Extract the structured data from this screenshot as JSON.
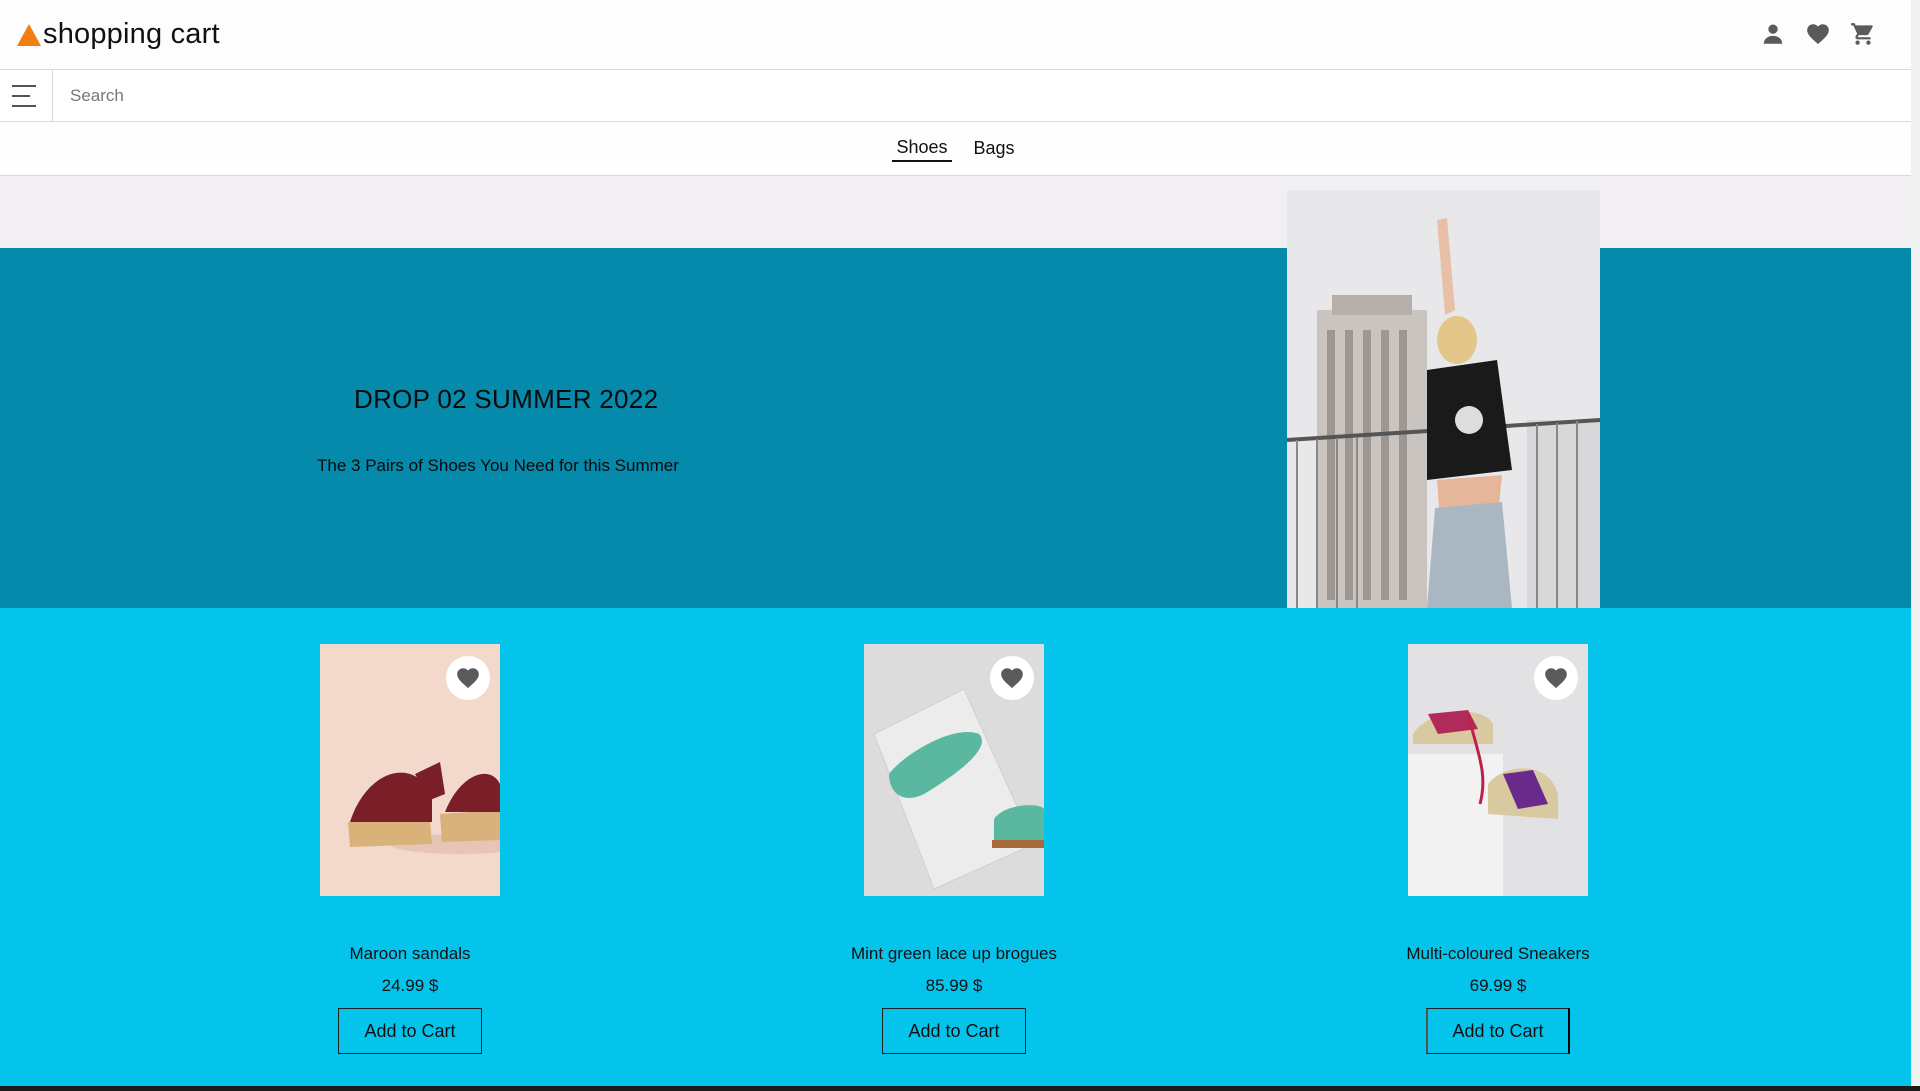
{
  "header": {
    "logo_text": "shopping cart",
    "logo_icon": "orange-triangle-logo",
    "icons": [
      "account-icon",
      "favorites-heart-icon",
      "cart-icon"
    ]
  },
  "search": {
    "placeholder": "Search",
    "value": "",
    "menu_icon": "hamburger-menu-icon"
  },
  "nav": {
    "tabs": [
      {
        "label": "Shoes",
        "active": true
      },
      {
        "label": "Bags",
        "active": false
      }
    ]
  },
  "hero": {
    "title": "DROP 02 SUMMER 2022",
    "subtitle": "The 3 Pairs of Shoes You Need for this Summer",
    "background_color": "#068aab"
  },
  "products": {
    "background_color": "#05c4ec",
    "items": [
      {
        "name": "Maroon sandals",
        "price": "24.99 $",
        "button": "Add to Cart"
      },
      {
        "name": "Mint green lace up brogues",
        "price": "85.99 $",
        "button": "Add to Cart"
      },
      {
        "name": "Multi-coloured Sneakers",
        "price": "69.99 $",
        "button": "Add to Cart"
      }
    ]
  },
  "colors": {
    "accent": "#f07e10",
    "hero": "#068aab",
    "products": "#05c4ec"
  }
}
